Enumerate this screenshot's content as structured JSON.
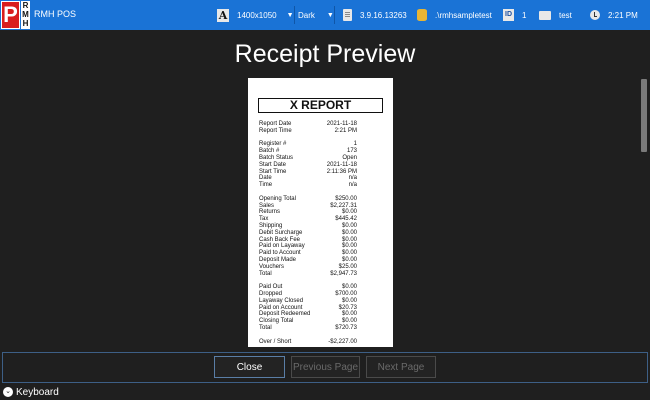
{
  "app": {
    "logo_letter": "P",
    "logo_side": "RMH",
    "name": "RMH POS"
  },
  "topbar": {
    "resolution": "1400x1050",
    "theme": "Dark",
    "version": "3.9.16.13263",
    "database": ".\\rmhsampletest",
    "register": "1",
    "user": "test",
    "time": "2:21 PM"
  },
  "page": {
    "title": "Receipt Preview"
  },
  "receipt": {
    "heading": "X REPORT",
    "sections": [
      [
        {
          "label": "Report Date",
          "value": "2021-11-18"
        },
        {
          "label": "Report Time",
          "value": "2:21 PM"
        }
      ],
      [
        {
          "label": "Register #",
          "value": "1"
        },
        {
          "label": "Batch #",
          "value": "173"
        },
        {
          "label": "Batch Status",
          "value": "Open"
        },
        {
          "label": "Start Date",
          "value": "2021-11-18"
        },
        {
          "label": "Start Time",
          "value": "2:11:36 PM"
        },
        {
          "label": "Date",
          "value": "n/a"
        },
        {
          "label": "Time",
          "value": "n/a"
        }
      ],
      [
        {
          "label": "Opening Total",
          "value": "$250.00"
        },
        {
          "label": "Sales",
          "value": "$2,227.31"
        },
        {
          "label": "Returns",
          "value": "$0.00"
        },
        {
          "label": "Tax",
          "value": "$445.42"
        },
        {
          "label": "Shipping",
          "value": "$0.00"
        },
        {
          "label": "Debit Surcharge",
          "value": "$0.00"
        },
        {
          "label": "Cash Back Fee",
          "value": "$0.00"
        },
        {
          "label": "Paid on Layaway",
          "value": "$0.00"
        },
        {
          "label": "Paid to Account",
          "value": "$0.00"
        },
        {
          "label": "Deposit Made",
          "value": "$0.00"
        },
        {
          "label": "Vouchers",
          "value": "$25.00"
        },
        {
          "label": "Total",
          "value": "$2,947.73"
        }
      ],
      [
        {
          "label": "Paid Out",
          "value": "$0.00"
        },
        {
          "label": "Dropped",
          "value": "$700.00"
        },
        {
          "label": "Layaway Closed",
          "value": "$0.00"
        },
        {
          "label": "Paid on Account",
          "value": "$20.73"
        },
        {
          "label": "Deposit Redeemed",
          "value": "$0.00"
        },
        {
          "label": "Closing Total",
          "value": "$0.00"
        },
        {
          "label": "Total",
          "value": "$720.73"
        }
      ],
      [
        {
          "label": "Over / Short",
          "value": "-$2,227.00"
        }
      ]
    ]
  },
  "buttons": {
    "close": "Close",
    "previous": "Previous Page",
    "next": "Next Page"
  },
  "keyboard": {
    "label": "Keyboard"
  }
}
